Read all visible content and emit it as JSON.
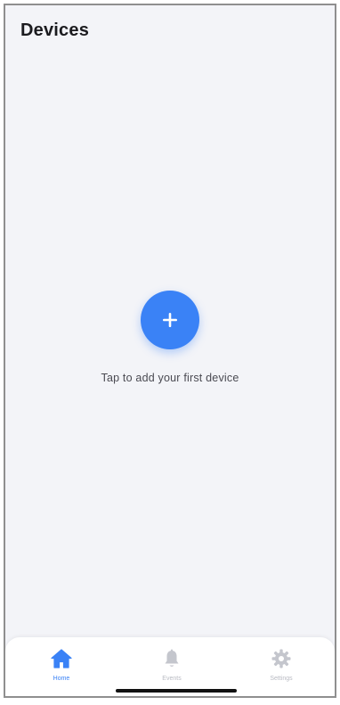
{
  "header": {
    "title": "Devices"
  },
  "empty_state": {
    "hint": "Tap to add your first device",
    "add_icon": "plus-icon"
  },
  "tab_bar": {
    "active_color": "#3a82f6",
    "inactive_color": "#b9bbc3",
    "items": [
      {
        "label": "Home",
        "icon": "home-icon",
        "active": true
      },
      {
        "label": "Events",
        "icon": "bell-icon",
        "active": false
      },
      {
        "label": "Settings",
        "icon": "gear-icon",
        "active": false
      }
    ]
  },
  "colors": {
    "accent": "#3a82f6",
    "background": "#f3f4f8"
  }
}
